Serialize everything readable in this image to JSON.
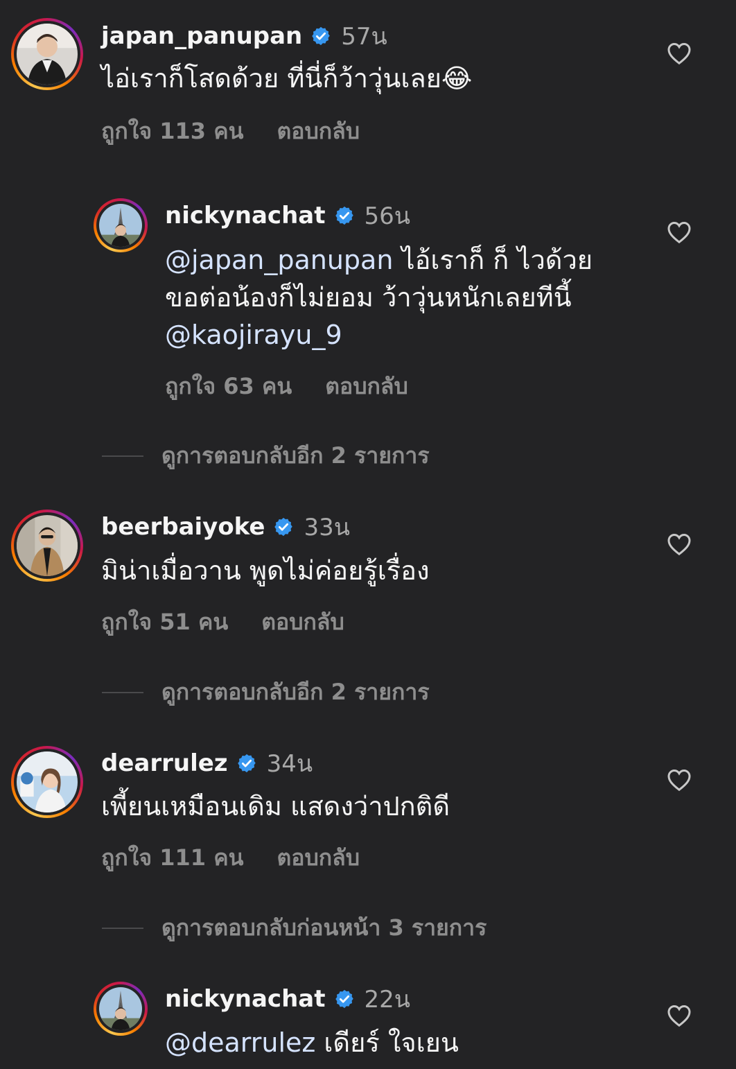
{
  "comments": [
    {
      "username": "japan_panupan",
      "time": "57น",
      "text": "ไอ่เราก็โสดด้วย ที่นี่ก็ว้าวุ่นเลย😂",
      "likes": "ถูกใจ 113 คน",
      "reply": "ตอบกลับ"
    },
    {
      "username": "nickynachat",
      "time": "56น",
      "mention": "@japan_panupan",
      "text": " ไอ้เราก็ ก็ ไวด้วย\nขอต่อน้องก็ไม่ยอม ว้าวุ่นหนักเลยทีนี้\n",
      "mention2": "@kaojirayu_9",
      "likes": "ถูกใจ 63 คน",
      "reply": "ตอบกลับ",
      "view_more": "ดูการตอบกลับอีก 2 รายการ"
    },
    {
      "username": "beerbaiyoke",
      "time": "33น",
      "text": "มิน่าเมื่อวาน พูดไม่ค่อยรู้เรื่อง",
      "likes": "ถูกใจ 51 คน",
      "reply": "ตอบกลับ",
      "view_more": "ดูการตอบกลับอีก 2 รายการ"
    },
    {
      "username": "dearrulez",
      "time": "34น",
      "text": "เพี้ยนเหมือนเดิม แสดงว่าปกติดี",
      "likes": "ถูกใจ 111 คน",
      "reply": "ตอบกลับ",
      "view_more": "ดูการตอบกลับก่อนหน้า 3 รายการ"
    },
    {
      "username": "nickynachat",
      "time": "22น",
      "mention": "@dearrulez",
      "text": " เดียร์ ใจเยน"
    }
  ],
  "icons": {
    "verified": "verified-badge-icon",
    "like": "heart-icon"
  },
  "colors": {
    "background": "#232325",
    "verified": "#3797f0",
    "secondary_text": "#8e8e8e",
    "mention": "#d5e3ff"
  }
}
